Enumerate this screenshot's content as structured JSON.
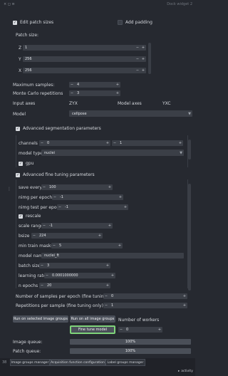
{
  "header": {
    "controls": "× ◻ ≡",
    "title": "Dock widget 2"
  },
  "patch": {
    "edit_label": "Edit patch sizes",
    "padding_label": "Add padding",
    "size_label": "Patch size:",
    "z_label": "Z",
    "z_value": "1",
    "y_label": "Y",
    "y_value": "256",
    "x_label": "X",
    "x_value": "256"
  },
  "samples": {
    "max_label": "Maximum samples:",
    "max_value": "4",
    "mc_label": "Monte Carlo repetitions",
    "mc_value": "3"
  },
  "axes": {
    "input_label": "Input axes",
    "input_value": "ZYX",
    "model_label": "Model axes",
    "model_value": "YXC"
  },
  "model": {
    "label": "Model",
    "value": "cellpose"
  },
  "seg": {
    "header": "Advanced segmentation parameters",
    "channels_label": "channels",
    "channel_a": "0",
    "channel_b": "1",
    "model_type_label": "model type",
    "model_type_value": "nuclei",
    "gpu_label": "gpu"
  },
  "ft": {
    "header": "Advanced fine tuning parameters",
    "save_every_label": "save every",
    "save_every_value": "100",
    "nimg_label": "nimg per epoch",
    "nimg_value": "-1",
    "nimg_test_label": "nimg test per epoch",
    "nimg_test_value": "-1",
    "rescale_label": "rescale",
    "scale_range_label": "scale range",
    "scale_range_value": "-1",
    "bsize_label": "bsize",
    "bsize_value": "224",
    "min_masks_label": "min train masks",
    "min_masks_value": "5",
    "model_name_label": "model name",
    "model_name_value": "nuclei_ft",
    "batch_label": "batch size",
    "batch_value": "3",
    "lr_label": "learning rate",
    "lr_value": "0.0001000000",
    "epochs_label": "n epochs",
    "epochs_value": "20"
  },
  "bottom": {
    "samples_epoch_label": "Number of samples per epoch (fine tuning only):",
    "samples_epoch_value": "0",
    "reps_label": "Repetitions per sample (fine tuning only):",
    "reps_value": "1",
    "run_selected": "Run on selected image groups",
    "run_all": "Run on all image groups",
    "workers_label": "Number of workers",
    "fine_tune": "Fine tune model",
    "workers_value": "0",
    "image_queue_label": "Image queue:",
    "image_queue_value": "100%",
    "patch_queue_label": "Patch queue:",
    "patch_queue_value": "100%"
  },
  "status": {
    "left": "38",
    "tabs": [
      "Image groups manager",
      "Acquisition function configuration",
      "Label groups manager"
    ],
    "activity": "activity"
  },
  "colors": {
    "bg": "#262930",
    "input": "#3b3f47",
    "highlight": "#7fd37a"
  },
  "progress": {
    "image_queue": 100,
    "patch_queue": 100
  }
}
